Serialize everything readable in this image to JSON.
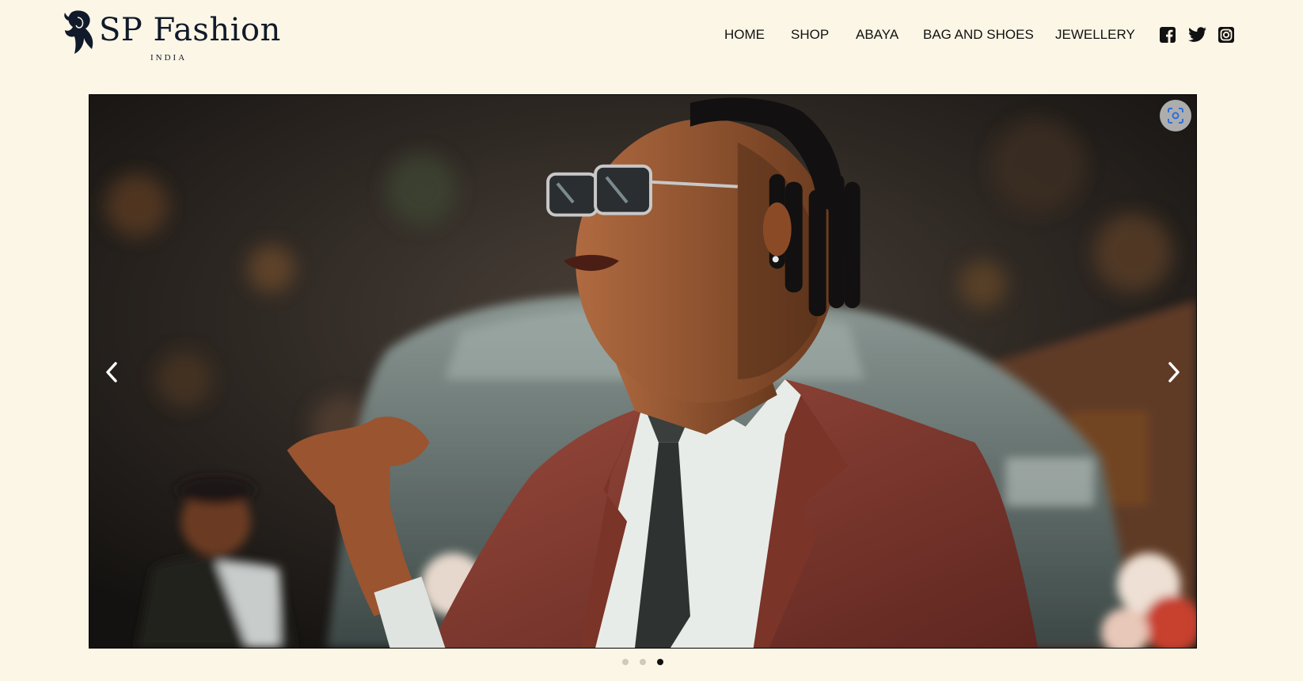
{
  "brand": {
    "name": "SP Fashion",
    "tagline": "INDIA",
    "logo_icon": "woman-silhouette-icon"
  },
  "nav": {
    "items": [
      {
        "label": "HOME"
      },
      {
        "label": "SHOP"
      },
      {
        "label": "ABAYA"
      },
      {
        "label": "BAG AND SHOES"
      },
      {
        "label": "JEWELLERY"
      }
    ]
  },
  "social": {
    "icons": [
      "facebook-icon",
      "twitter-icon",
      "instagram-icon"
    ]
  },
  "slider": {
    "image_description_icon": "hero-photo",
    "slide_count": 3,
    "active_slide": 3,
    "lens_icon": "visual-search-icon",
    "prev_icon": "chevron-left-icon",
    "next_icon": "chevron-right-icon"
  },
  "colors": {
    "background": "#fcf6e6",
    "text": "#111111",
    "logo": "#101a2a",
    "dot_active": "#111111",
    "dot_inactive": "#cfcabb"
  }
}
